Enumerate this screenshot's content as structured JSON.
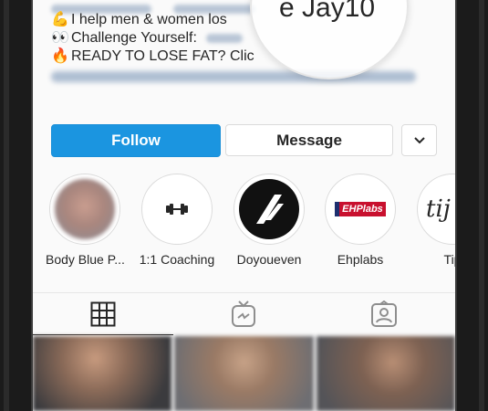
{
  "bio": {
    "line1_emoji": "💪",
    "line1_text": "I help men & women los",
    "line2_emoji": "👀",
    "line2_text": "Challenge Yourself:",
    "line3_emoji": "🔥",
    "line3_text": "READY TO LOSE FAT? Clic",
    "magnifier_text": "e Jay10"
  },
  "buttons": {
    "follow": "Follow",
    "message": "Message",
    "more_icon": "chevron-down-icon"
  },
  "highlights": [
    {
      "label": "Body Blue P..."
    },
    {
      "label": "1:1 Coaching"
    },
    {
      "label": "Doyoueven"
    },
    {
      "label": "Ehplabs"
    },
    {
      "label": "Tip"
    }
  ],
  "highlight_badges": {
    "ehplabs": "EHPlabs",
    "tip": "tij"
  },
  "tabs": [
    {
      "icon": "grid-icon"
    },
    {
      "icon": "igtv-icon"
    },
    {
      "icon": "tagged-icon"
    }
  ],
  "colors": {
    "follow_blue": "#1b95e0",
    "text": "#262626",
    "border": "#dbdbdb"
  }
}
